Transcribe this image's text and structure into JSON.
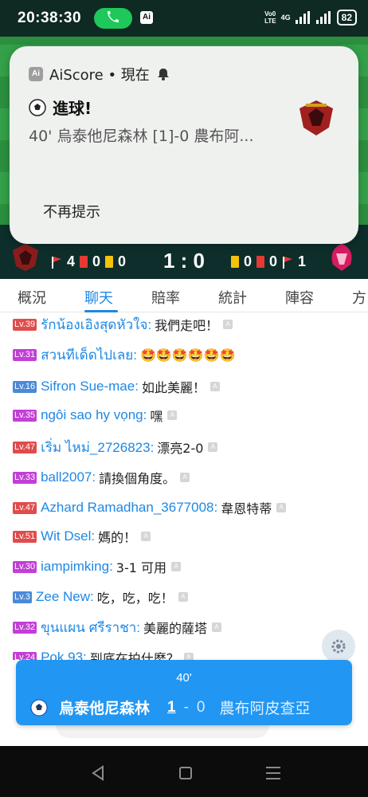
{
  "status_bar": {
    "time": "20:38:30",
    "volte_line1": "Vo0",
    "volte_line2": "LTE",
    "network": "4G",
    "battery": "82"
  },
  "background": {
    "home_corners": "4",
    "home_red": "0",
    "home_yellow": "0",
    "score": "1 : 0",
    "away_yellow": "0",
    "away_red": "0",
    "away_corners": "1"
  },
  "notification": {
    "app_name": "AiScore • 現在",
    "title": "進球!",
    "body": "40' 烏泰他尼森林 [1]-0 農布阿...",
    "action": "不再提示"
  },
  "tabs": [
    "概況",
    "聊天",
    "賠率",
    "統計",
    "陣容",
    "方"
  ],
  "active_tab": "聊天",
  "chat": [
    {
      "level": "Lv.39",
      "level_color": "#e04c4c",
      "user": "รักน้องเอิงสุดหัวใจ:",
      "text": "我們走吧！"
    },
    {
      "level": "Lv.31",
      "level_color": "#c23fd6",
      "user": "สวนทีเด็ดไปเลย:",
      "text": "🤩🤩🤩🤩🤩🤩"
    },
    {
      "level": "Lv.16",
      "level_color": "#4a8ad8",
      "user": "Sifron Sue-mae:",
      "text": "如此美麗！"
    },
    {
      "level": "Lv.35",
      "level_color": "#c23fd6",
      "user": "ngôi sao hy vọng:",
      "text": "嘿"
    },
    {
      "level": "Lv.47",
      "level_color": "#e04c4c",
      "user": "เริ่ม ไหม่_2726823:",
      "text": "漂亮2-0"
    },
    {
      "level": "Lv.33",
      "level_color": "#c23fd6",
      "user": "ball2007:",
      "text": "請換個角度。"
    },
    {
      "level": "Lv.47",
      "level_color": "#e04c4c",
      "user": "Azhard Ramadhan_3677008:",
      "text": "韋恩特蒂"
    },
    {
      "level": "Lv.51",
      "level_color": "#e04c4c",
      "user": "Wit Dsel:",
      "text": "媽的！"
    },
    {
      "level": "Lv.30",
      "level_color": "#c23fd6",
      "user": "iampimking:",
      "text": "3-1 可用"
    },
    {
      "level": "Lv.3",
      "level_color": "#4a8ad8",
      "user": "Zee New:",
      "text": "吃，吃，吃！"
    },
    {
      "level": "Lv.32",
      "level_color": "#c23fd6",
      "user": "ขุนแผน ศรีราชา:",
      "text": "美麗的薩塔"
    },
    {
      "level": "Lv.24",
      "level_color": "#c23fd6",
      "user": "Pok 93:",
      "text": "到底在拍什麼？"
    }
  ],
  "goal_banner": {
    "minute": "40'",
    "home_team": "烏泰他尼森林",
    "home_score": "1",
    "dash": "-",
    "away_score": "0",
    "away_team": "農布阿皮查亞"
  },
  "icons": {
    "ball": "soccer-ball-icon",
    "bell": "bell-icon",
    "settings": "gear-icon",
    "translate": "translate-icon"
  }
}
